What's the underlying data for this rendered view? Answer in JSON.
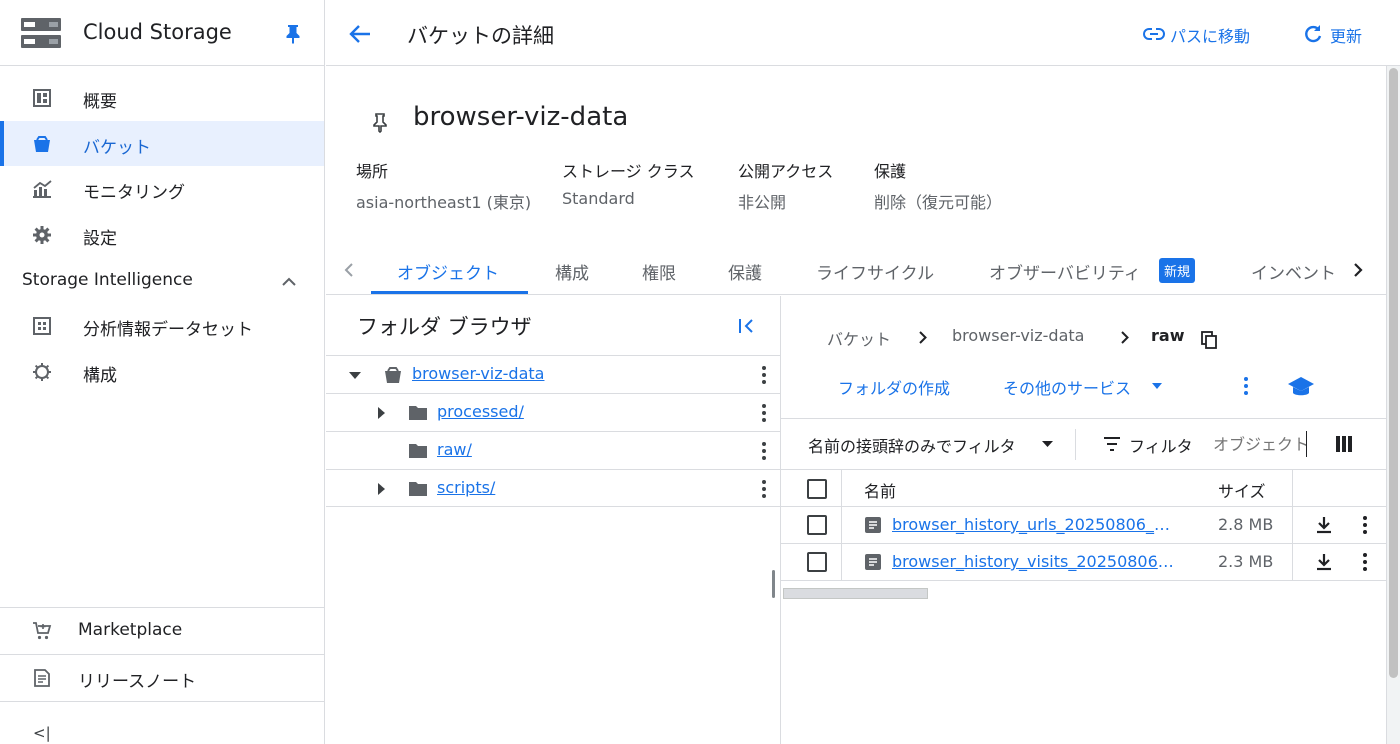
{
  "sidebar": {
    "title": "Cloud Storage",
    "items": [
      {
        "label": "概要",
        "icon": "dashboard-icon"
      },
      {
        "label": "バケット",
        "icon": "bucket-icon",
        "active": true
      },
      {
        "label": "モニタリング",
        "icon": "monitoring-chart-icon"
      },
      {
        "label": "設定",
        "icon": "gear-icon"
      }
    ],
    "section_title": "Storage Intelligence",
    "section_items": [
      {
        "label": "分析情報データセット",
        "icon": "dataset-icon"
      },
      {
        "label": "構成",
        "icon": "config-icon"
      }
    ],
    "footer_items": [
      {
        "label": "Marketplace",
        "icon": "cart-icon"
      },
      {
        "label": "リリースノート",
        "icon": "release-notes-icon"
      }
    ],
    "collapse_glyph": "<|"
  },
  "header": {
    "title": "バケットの詳細",
    "go_to_path_label": "パスに移動",
    "refresh_label": "更新"
  },
  "bucket": {
    "name": "browser-viz-data",
    "properties": [
      {
        "label": "場所",
        "value": "asia-northeast1 (東京)"
      },
      {
        "label": "ストレージ クラス",
        "value": "Standard"
      },
      {
        "label": "公開アクセス",
        "value": "非公開"
      },
      {
        "label": "保護",
        "value": "削除（復元可能）"
      }
    ]
  },
  "tabs": {
    "items": [
      "オブジェクト",
      "構成",
      "権限",
      "保護",
      "ライフサイクル",
      "オブザーバビリティ",
      "インベントリ"
    ],
    "active_index": 0,
    "new_badge": "新規"
  },
  "folder_browser": {
    "title": "フォルダ ブラウザ",
    "tree": [
      {
        "label": "browser-viz-data",
        "type": "bucket",
        "expanded": true
      },
      {
        "label": "processed/",
        "type": "folder",
        "expandable": true
      },
      {
        "label": "raw/",
        "type": "folder",
        "expandable": false
      },
      {
        "label": "scripts/",
        "type": "folder",
        "expandable": true
      }
    ]
  },
  "breadcrumb": {
    "items": [
      "バケット",
      "browser-viz-data",
      "raw"
    ]
  },
  "actions": {
    "create_folder": "フォルダの作成",
    "other_services": "その他のサービス"
  },
  "filter_bar": {
    "prefix_filter": "名前の接頭辞のみでフィルタ",
    "filter_label": "フィルタ",
    "filter_placeholder": "オブジェクト"
  },
  "table": {
    "columns": {
      "name": "名前",
      "size": "サイズ"
    },
    "rows": [
      {
        "name": "browser_history_urls_20250806_2…",
        "size": "2.8 MB"
      },
      {
        "name": "browser_history_visits_20250806_…",
        "size": "2.3 MB"
      }
    ]
  },
  "colors": {
    "accent": "#1a73e8",
    "active_bg": "#e8f0fe",
    "text": "#202124",
    "muted": "#5f6368",
    "divider": "#dadce0"
  }
}
